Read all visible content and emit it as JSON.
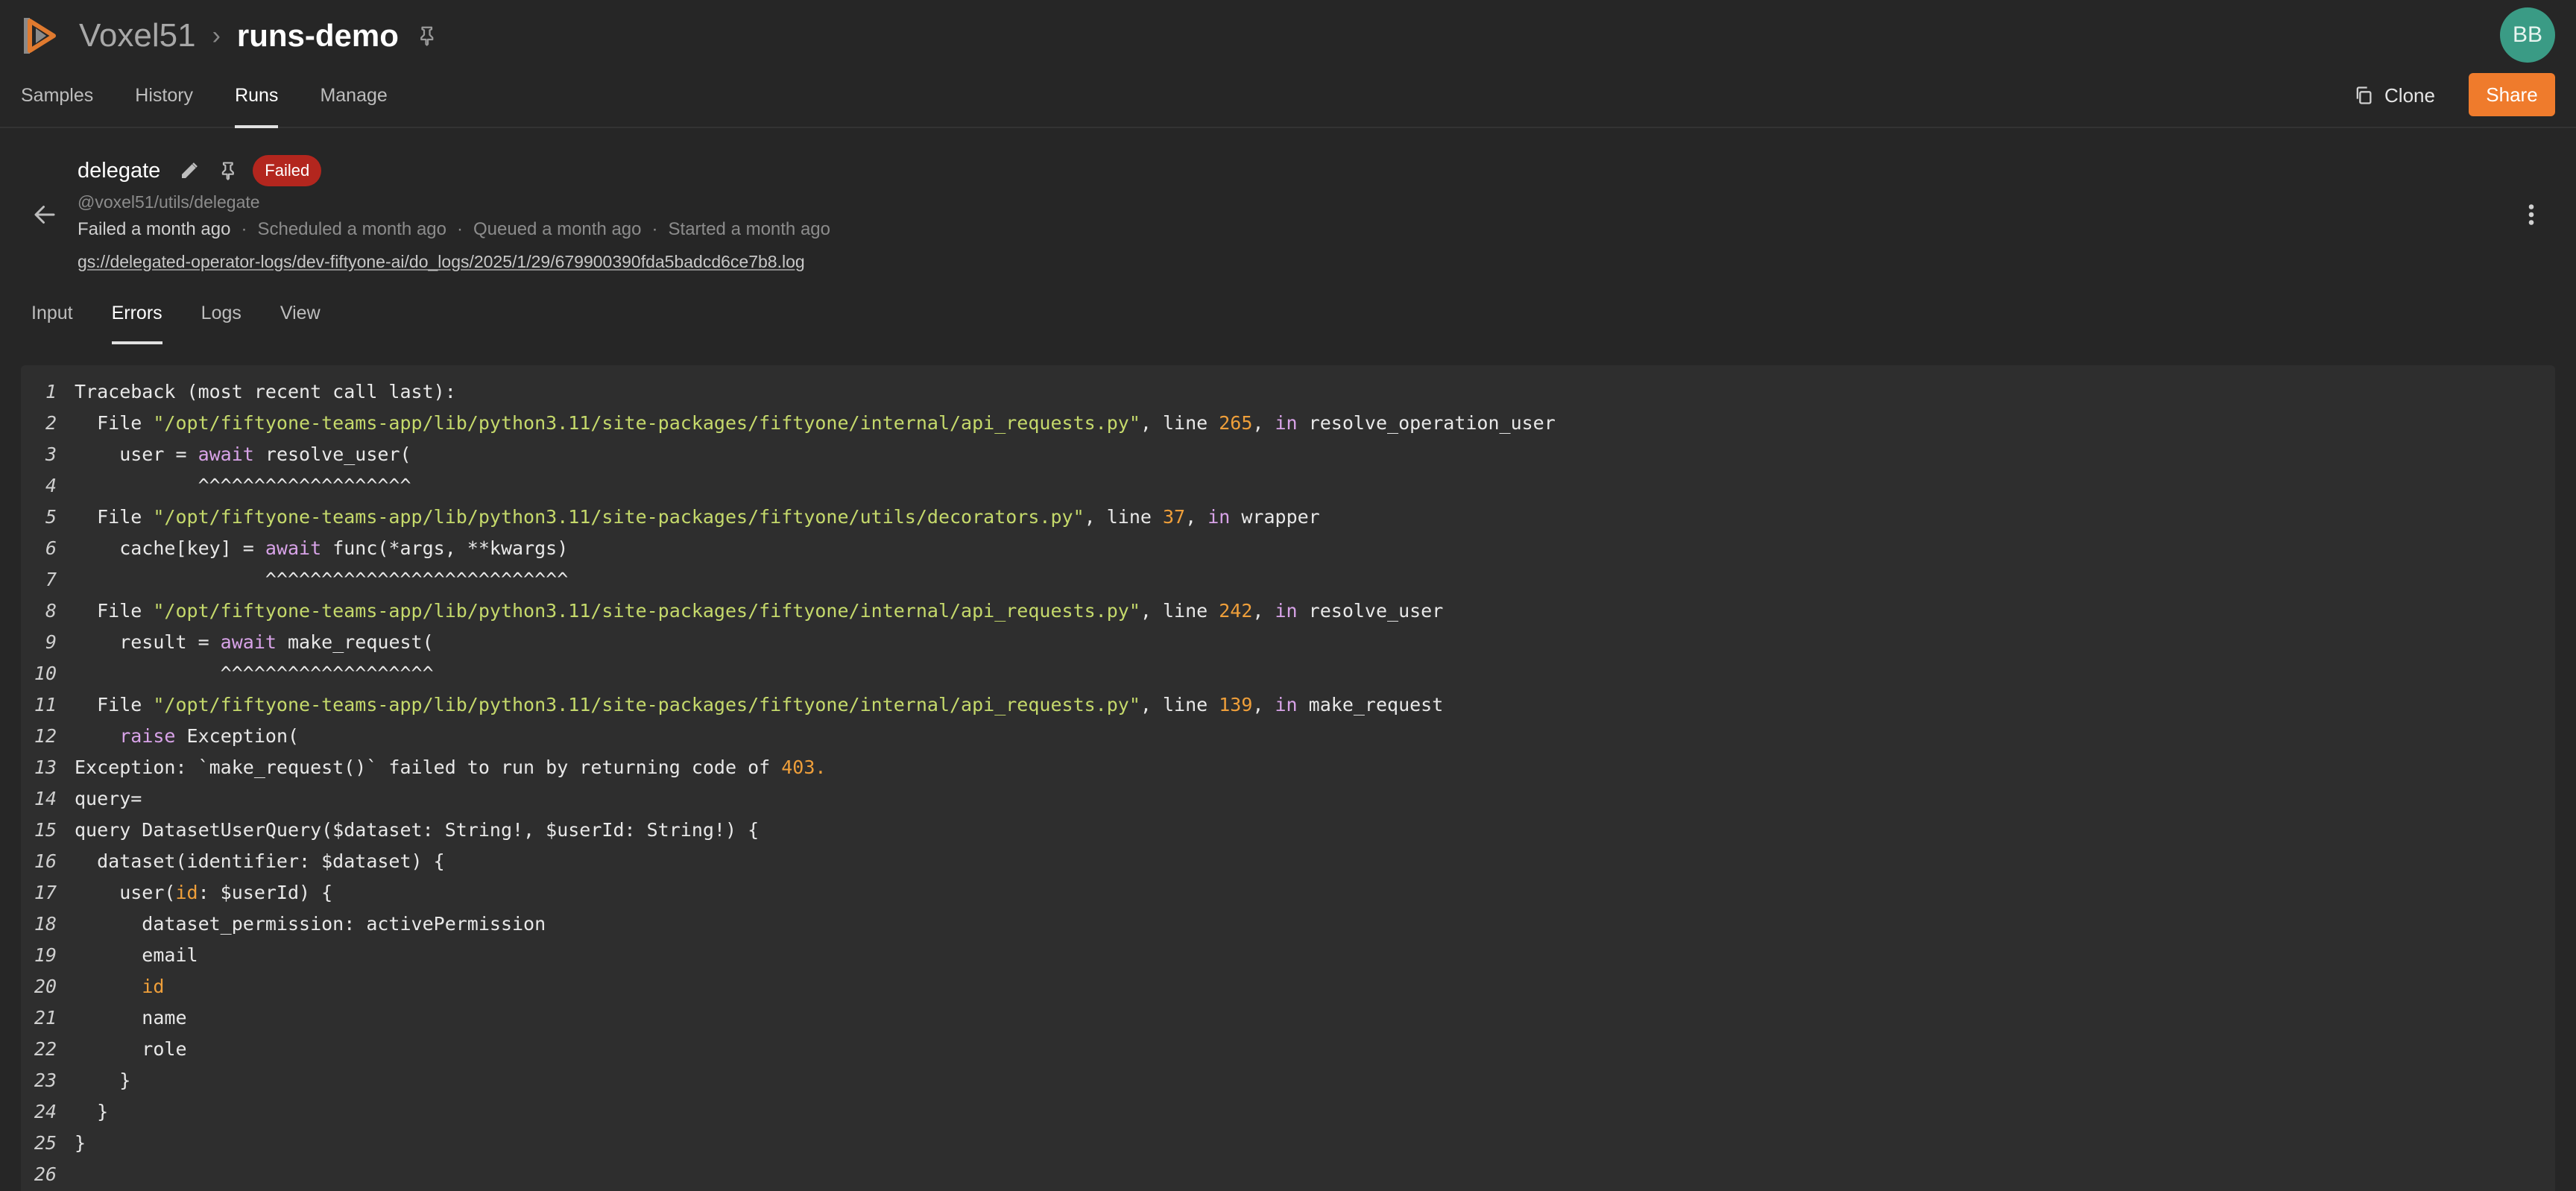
{
  "header": {
    "brand": "Voxel51",
    "breadcrumb_separator": "›",
    "dataset_name": "runs-demo",
    "avatar_initials": "BB"
  },
  "nav": {
    "tabs": [
      {
        "label": "Samples",
        "active": false
      },
      {
        "label": "History",
        "active": false
      },
      {
        "label": "Runs",
        "active": true
      },
      {
        "label": "Manage",
        "active": false
      }
    ],
    "clone_label": "Clone",
    "share_label": "Share"
  },
  "colors": {
    "accent": "#ef7b2c",
    "failed": "#b3261e",
    "avatar": "#3a9b85"
  },
  "run": {
    "name": "delegate",
    "status": "Failed",
    "operator_uri": "@voxel51/utils/delegate",
    "timeline": [
      "Failed a month ago",
      "Scheduled a month ago",
      "Queued a month ago",
      "Started a month ago"
    ],
    "log_path": "gs://delegated-operator-logs/dev-fiftyone-ai/do_logs/2025/1/29/679900390fda5badcd6ce7b8.log",
    "tabs": [
      {
        "label": "Input",
        "active": false
      },
      {
        "label": "Errors",
        "active": true
      },
      {
        "label": "Logs",
        "active": false
      },
      {
        "label": "View",
        "active": false
      }
    ]
  },
  "icons": {
    "logo": "voxel51-logo-icon",
    "pin": "pin-icon",
    "edit": "pencil-icon",
    "back": "arrow-left-icon",
    "more": "more-vertical-icon",
    "clone": "copy-icon"
  },
  "error_lines": [
    [
      {
        "t": "Traceback (most recent call last):"
      }
    ],
    [
      {
        "t": "  File "
      },
      {
        "t": "\"/opt/fiftyone-teams-app/lib/python3.11/site-packages/fiftyone/internal/api_requests.py\"",
        "c": "s"
      },
      {
        "t": ", line "
      },
      {
        "t": "265",
        "c": "n"
      },
      {
        "t": ", "
      },
      {
        "t": "in",
        "c": "k"
      },
      {
        "t": " resolve_operation_user"
      }
    ],
    [
      {
        "t": "    user = "
      },
      {
        "t": "await",
        "c": "k"
      },
      {
        "t": " resolve_user("
      }
    ],
    [
      {
        "t": "           ^^^^^^^^^^^^^^^^^^^"
      }
    ],
    [
      {
        "t": "  File "
      },
      {
        "t": "\"/opt/fiftyone-teams-app/lib/python3.11/site-packages/fiftyone/utils/decorators.py\"",
        "c": "s"
      },
      {
        "t": ", line "
      },
      {
        "t": "37",
        "c": "n"
      },
      {
        "t": ", "
      },
      {
        "t": "in",
        "c": "k"
      },
      {
        "t": " wrapper"
      }
    ],
    [
      {
        "t": "    cache[key] = "
      },
      {
        "t": "await",
        "c": "k"
      },
      {
        "t": " func(*args, **kwargs)"
      }
    ],
    [
      {
        "t": "                 ^^^^^^^^^^^^^^^^^^^^^^^^^^^"
      }
    ],
    [
      {
        "t": "  File "
      },
      {
        "t": "\"/opt/fiftyone-teams-app/lib/python3.11/site-packages/fiftyone/internal/api_requests.py\"",
        "c": "s"
      },
      {
        "t": ", line "
      },
      {
        "t": "242",
        "c": "n"
      },
      {
        "t": ", "
      },
      {
        "t": "in",
        "c": "k"
      },
      {
        "t": " resolve_user"
      }
    ],
    [
      {
        "t": "    result = "
      },
      {
        "t": "await",
        "c": "k"
      },
      {
        "t": " make_request("
      }
    ],
    [
      {
        "t": "             ^^^^^^^^^^^^^^^^^^^"
      }
    ],
    [
      {
        "t": "  File "
      },
      {
        "t": "\"/opt/fiftyone-teams-app/lib/python3.11/site-packages/fiftyone/internal/api_requests.py\"",
        "c": "s"
      },
      {
        "t": ", line "
      },
      {
        "t": "139",
        "c": "n"
      },
      {
        "t": ", "
      },
      {
        "t": "in",
        "c": "k"
      },
      {
        "t": " make_request"
      }
    ],
    [
      {
        "t": "    "
      },
      {
        "t": "raise",
        "c": "k"
      },
      {
        "t": " Exception("
      }
    ],
    [
      {
        "t": "Exception: `make_request()` failed to run by returning code of "
      },
      {
        "t": "403.",
        "c": "n"
      }
    ],
    [
      {
        "t": "query="
      }
    ],
    [
      {
        "t": "query DatasetUserQuery($dataset: String!, $userId: String!) {"
      }
    ],
    [
      {
        "t": "  dataset(identifier: $dataset) {"
      }
    ],
    [
      {
        "t": "    user("
      },
      {
        "t": "id",
        "c": "a"
      },
      {
        "t": ": $userId) {"
      }
    ],
    [
      {
        "t": "      dataset_permission: activePermission"
      }
    ],
    [
      {
        "t": "      email"
      }
    ],
    [
      {
        "t": "      "
      },
      {
        "t": "id",
        "c": "a"
      }
    ],
    [
      {
        "t": "      name"
      }
    ],
    [
      {
        "t": "      role"
      }
    ],
    [
      {
        "t": "    }"
      }
    ],
    [
      {
        "t": "  }"
      }
    ],
    [
      {
        "t": "}"
      }
    ],
    [
      {
        "t": ""
      }
    ]
  ]
}
